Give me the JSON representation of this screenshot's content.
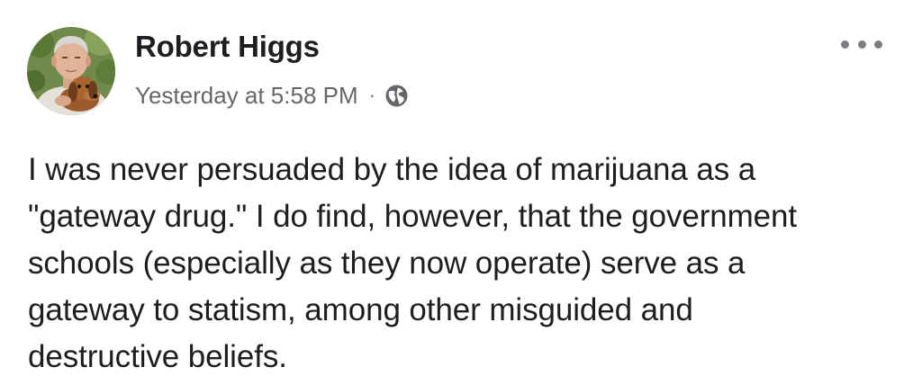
{
  "post": {
    "author": {
      "name": "Robert Higgs",
      "avatar_icon": "profile-photo-man-with-dachshund"
    },
    "timestamp": "Yesterday at 5:58 PM",
    "separator": "·",
    "privacy_icon": "globe-icon",
    "more_icon": "more-options-icon",
    "body_lines": [
      "I was never persuaded by the idea of marijuana as a",
      "\"gateway drug.\" I do find, however, that the government",
      "schools (especially as they now operate) serve as a",
      "gateway to statism, among other misguided and",
      "destructive beliefs."
    ]
  },
  "colors": {
    "text_primary": "#1c1e21",
    "text_secondary": "#65676b",
    "background": "#ffffff"
  }
}
